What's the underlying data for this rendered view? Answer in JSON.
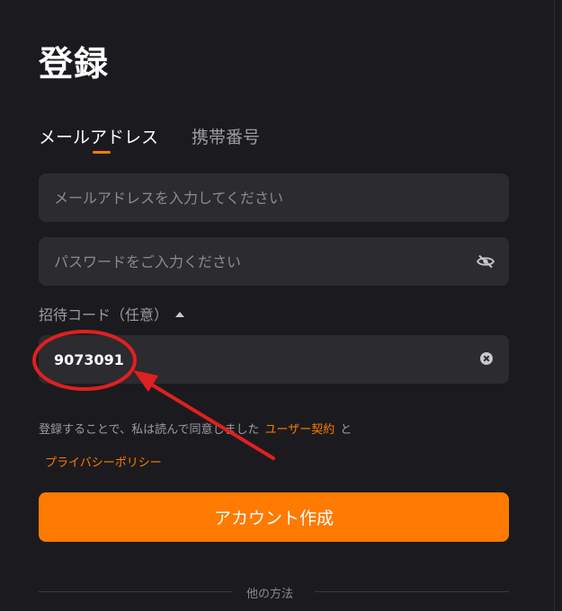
{
  "page": {
    "title": "登録"
  },
  "tabs": [
    {
      "label": "メールアドレス",
      "active": true
    },
    {
      "label": "携帯番号",
      "active": false
    }
  ],
  "email": {
    "placeholder": "メールアドレスを入力してください",
    "value": ""
  },
  "password": {
    "placeholder": "パスワードをご入力ください",
    "value": "",
    "toggle_icon": "eye-off-icon"
  },
  "invite": {
    "label": "招待コード（任意）",
    "value": "9073091",
    "clear_icon": "clear-circle-icon"
  },
  "agreement": {
    "text": "登録することで、私は読んで同意しました",
    "terms_link": "ユーザー契約",
    "and_text": "と",
    "privacy_link": "プライバシーポリシー"
  },
  "submit": {
    "label": "アカウント作成"
  },
  "divider": {
    "label": "他の方法"
  },
  "colors": {
    "background": "#1b1b1f",
    "field": "#2b2b30",
    "accent": "#ff7a00",
    "annotation": "#e02020"
  }
}
